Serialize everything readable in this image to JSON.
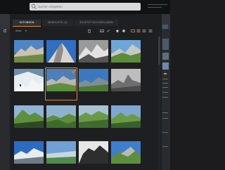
{
  "search": {
    "placeholder": "Suchen eingeben"
  },
  "tabs": [
    {
      "label": "GEFUNDEN",
      "active": true
    },
    {
      "label": "MERKLISTE (3)",
      "active": false
    },
    {
      "label": "ZULETZT HOCHGELADEN",
      "active": false
    }
  ],
  "filter": {
    "label": "Alles",
    "caret": "▾"
  },
  "toolbar_icons": [
    "trash-icon",
    "image-icon",
    "edit-icon",
    "star-icon",
    "grid-view-icon",
    "list-view-icon",
    "list-view-icon",
    "menu-icon"
  ],
  "colors": {
    "accent": "#e08a2a",
    "background": "#1c1c1e",
    "topbar": "#111214",
    "panel": "#2a2b2e"
  },
  "grid": {
    "selected_index": 5,
    "thumbnails": [
      {
        "subject": "mountain-landscape"
      },
      {
        "subject": "mountain-peak-sky"
      },
      {
        "subject": "mountain-grayscale"
      },
      {
        "subject": "mountain-green-slopes"
      },
      {
        "subject": "snowy-slope-hiker"
      },
      {
        "subject": "mountain-cliffs-sky"
      },
      {
        "subject": "mountain-valley"
      },
      {
        "subject": "mountain-peak-grayscale"
      },
      {
        "subject": "green-mountain-sunlit"
      },
      {
        "subject": "green-valley"
      },
      {
        "subject": "green-alpine-peaks"
      },
      {
        "subject": "green-ridge"
      },
      {
        "subject": "snowy-peak-blue-sky"
      },
      {
        "subject": "mountain-lake"
      },
      {
        "subject": "mountain-silhouette-grayscale"
      },
      {
        "subject": "mountain-green-blue-sky"
      }
    ]
  }
}
